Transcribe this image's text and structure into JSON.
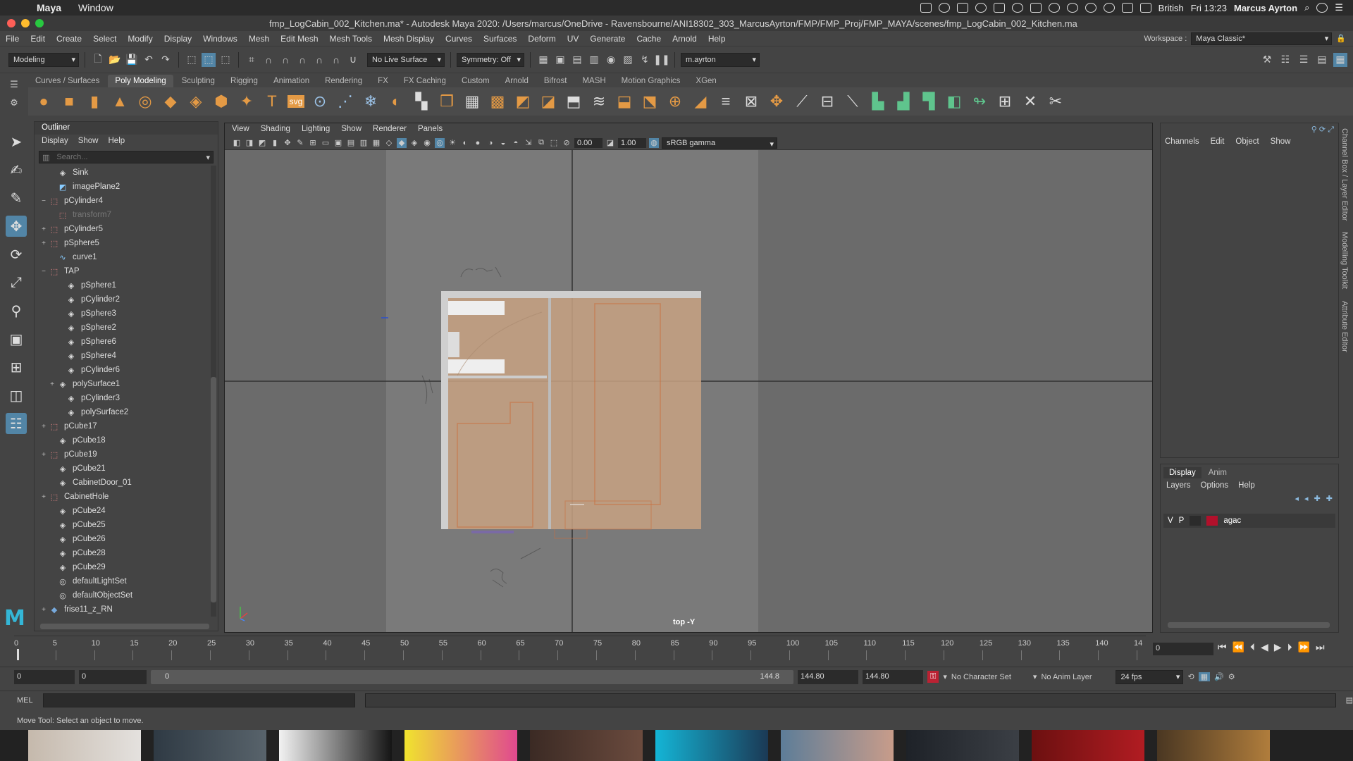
{
  "macbar": {
    "app": "Maya",
    "window_menu": "Window",
    "keyboard": "British",
    "clock": "Fri 13:23",
    "user": "Marcus Ayrton"
  },
  "titlebar": {
    "title": "fmp_LogCabin_002_Kitchen.ma* - Autodesk Maya 2020: /Users/marcus/OneDrive - Ravensbourne/ANI18302_303_MarcusAyrton/FMP/FMP_Proj/FMP_MAYA/scenes/fmp_LogCabin_002_Kitchen.ma"
  },
  "menubar": {
    "items": [
      "File",
      "Edit",
      "Create",
      "Select",
      "Modify",
      "Display",
      "Windows",
      "Mesh",
      "Edit Mesh",
      "Mesh Tools",
      "Mesh Display",
      "Curves",
      "Surfaces",
      "Deform",
      "UV",
      "Generate",
      "Cache",
      "Arnold",
      "Help"
    ],
    "workspace_label": "Workspace :",
    "workspace_value": "Maya Classic*"
  },
  "statusline": {
    "menuset": "Modeling",
    "live_surface": "No Live Surface",
    "symmetry": "Symmetry: Off",
    "user": "m.ayrton"
  },
  "shelf": {
    "tabs": [
      "Curves / Surfaces",
      "Poly Modeling",
      "Sculpting",
      "Rigging",
      "Animation",
      "Rendering",
      "FX",
      "FX Caching",
      "Custom",
      "Arnold",
      "Bifrost",
      "MASH",
      "Motion Graphics",
      "XGen"
    ],
    "active_tab": "Poly Modeling"
  },
  "outliner": {
    "title": "Outliner",
    "menu": [
      "Display",
      "Show",
      "Help"
    ],
    "search_placeholder": "Search...",
    "items": [
      {
        "label": "Sink",
        "depth": 1,
        "icon": "mesh",
        "expander": ""
      },
      {
        "label": "imagePlane2",
        "depth": 1,
        "icon": "imageplane",
        "expander": ""
      },
      {
        "label": "pCylinder4",
        "depth": 0,
        "icon": "group",
        "expander": "−"
      },
      {
        "label": "transform7",
        "depth": 1,
        "icon": "group",
        "expander": "",
        "dim": true
      },
      {
        "label": "pCylinder5",
        "depth": 0,
        "icon": "group",
        "expander": "+"
      },
      {
        "label": "pSphere5",
        "depth": 0,
        "icon": "group",
        "expander": "+"
      },
      {
        "label": "curve1",
        "depth": 1,
        "icon": "curve",
        "expander": ""
      },
      {
        "label": "TAP",
        "depth": 0,
        "icon": "group",
        "expander": "−"
      },
      {
        "label": "pSphere1",
        "depth": 2,
        "icon": "mesh",
        "expander": ""
      },
      {
        "label": "pCylinder2",
        "depth": 2,
        "icon": "mesh",
        "expander": ""
      },
      {
        "label": "pSphere3",
        "depth": 2,
        "icon": "mesh",
        "expander": ""
      },
      {
        "label": "pSphere2",
        "depth": 2,
        "icon": "mesh",
        "expander": ""
      },
      {
        "label": "pSphere6",
        "depth": 2,
        "icon": "mesh",
        "expander": ""
      },
      {
        "label": "pSphere4",
        "depth": 2,
        "icon": "mesh",
        "expander": ""
      },
      {
        "label": "pCylinder6",
        "depth": 2,
        "icon": "mesh",
        "expander": ""
      },
      {
        "label": "polySurface1",
        "depth": 1,
        "icon": "mesh",
        "expander": "+"
      },
      {
        "label": "pCylinder3",
        "depth": 2,
        "icon": "mesh",
        "expander": ""
      },
      {
        "label": "polySurface2",
        "depth": 2,
        "icon": "mesh",
        "expander": ""
      },
      {
        "label": "pCube17",
        "depth": 0,
        "icon": "group",
        "expander": "+"
      },
      {
        "label": "pCube18",
        "depth": 1,
        "icon": "mesh",
        "expander": ""
      },
      {
        "label": "pCube19",
        "depth": 0,
        "icon": "group",
        "expander": "+"
      },
      {
        "label": "pCube21",
        "depth": 1,
        "icon": "mesh",
        "expander": ""
      },
      {
        "label": "CabinetDoor_01",
        "depth": 1,
        "icon": "mesh",
        "expander": ""
      },
      {
        "label": "CabinetHole",
        "depth": 0,
        "icon": "group",
        "expander": "+"
      },
      {
        "label": "pCube24",
        "depth": 1,
        "icon": "mesh",
        "expander": ""
      },
      {
        "label": "pCube25",
        "depth": 1,
        "icon": "mesh",
        "expander": ""
      },
      {
        "label": "pCube26",
        "depth": 1,
        "icon": "mesh",
        "expander": ""
      },
      {
        "label": "pCube28",
        "depth": 1,
        "icon": "mesh",
        "expander": ""
      },
      {
        "label": "pCube29",
        "depth": 1,
        "icon": "mesh",
        "expander": ""
      },
      {
        "label": "defaultLightSet",
        "depth": 1,
        "icon": "set",
        "expander": ""
      },
      {
        "label": "defaultObjectSet",
        "depth": 1,
        "icon": "set",
        "expander": ""
      },
      {
        "label": "frise11_z_RN",
        "depth": 0,
        "icon": "reference",
        "expander": "+"
      }
    ]
  },
  "viewport": {
    "menu": [
      "View",
      "Shading",
      "Lighting",
      "Show",
      "Renderer",
      "Panels"
    ],
    "exposure": "0.00",
    "gamma": "1.00",
    "color_space": "sRGB gamma",
    "camera": "top -Y"
  },
  "channelbox": {
    "menu": [
      "Channels",
      "Edit",
      "Object",
      "Show"
    ]
  },
  "layereditor": {
    "tabs": [
      "Display",
      "Anim"
    ],
    "active_tab": "Display",
    "menu": [
      "Layers",
      "Options",
      "Help"
    ],
    "layer": {
      "v": "V",
      "p": "P",
      "name": "agac",
      "color": "#b2102b"
    }
  },
  "sidetabs": [
    "Channel Box / Layer Editor",
    "Modelling Toolkit",
    "Attribute Editor"
  ],
  "timeslider": {
    "ticks": [
      "0",
      "5",
      "10",
      "15",
      "20",
      "25",
      "30",
      "35",
      "40",
      "45",
      "50",
      "55",
      "60",
      "65",
      "70",
      "75",
      "80",
      "85",
      "90",
      "95",
      "100",
      "105",
      "110",
      "115",
      "120",
      "125",
      "130",
      "135",
      "140",
      "14"
    ],
    "current_frame": "0"
  },
  "rangeslider": {
    "start": "0",
    "anim_start": "0",
    "range_start": "0",
    "range_end": "144.8",
    "anim_end": "144.80",
    "end": "144.80",
    "character_set": "No Character Set",
    "anim_layer": "No Anim Layer",
    "fps": "24 fps"
  },
  "cmdline": {
    "label": "MEL"
  },
  "helpline": {
    "text": "Move Tool: Select an object to move."
  },
  "colors": {
    "accent": "#5285a6",
    "shelf_orange": "#e49a45",
    "maya_logo": "#34b6d6",
    "plane_tint": "#c8a283"
  }
}
